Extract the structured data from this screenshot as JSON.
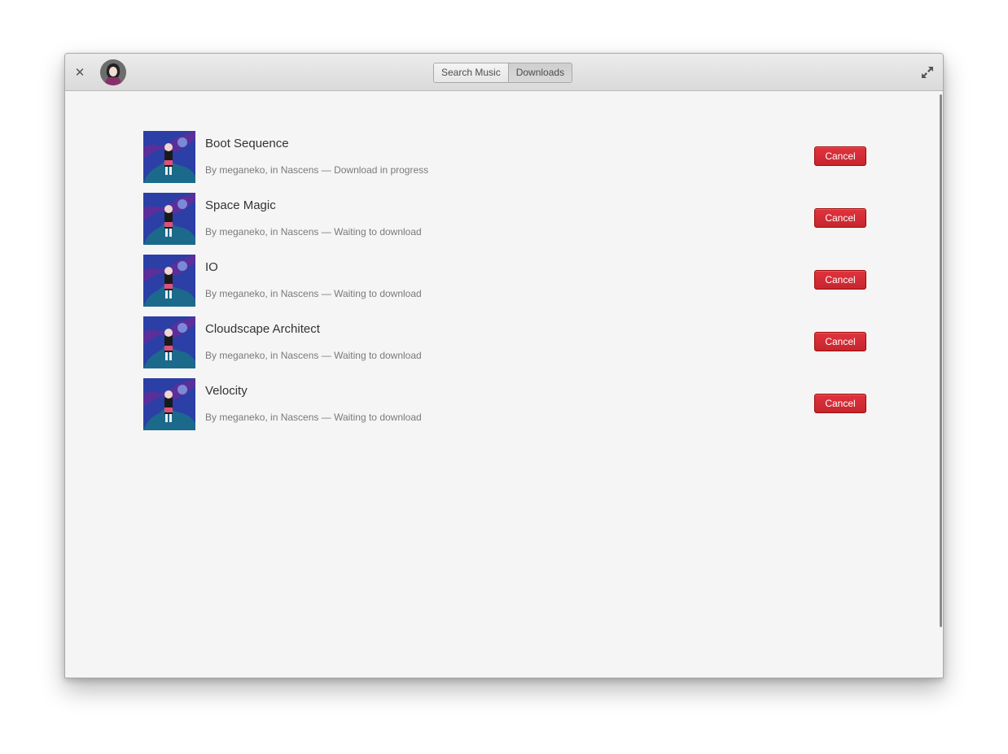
{
  "header": {
    "mode_tabs": [
      {
        "label": "Search Music",
        "active": false
      },
      {
        "label": "Downloads",
        "active": true
      }
    ]
  },
  "downloads": [
    {
      "title": "Boot Sequence",
      "subtitle": "By meganeko, in Nascens — Download in progress",
      "action": "Cancel"
    },
    {
      "title": "Space Magic",
      "subtitle": "By meganeko, in Nascens — Waiting to download",
      "action": "Cancel"
    },
    {
      "title": "IO",
      "subtitle": "By meganeko, in Nascens — Waiting to download",
      "action": "Cancel"
    },
    {
      "title": "Cloudscape Architect",
      "subtitle": "By meganeko, in Nascens — Waiting to download",
      "action": "Cancel"
    },
    {
      "title": "Velocity",
      "subtitle": "By meganeko, in Nascens — Waiting to download",
      "action": "Cancel"
    }
  ],
  "icons": {
    "close": "close-icon",
    "avatar": "avatar",
    "fullscreen": "fullscreen-icon",
    "album_art": "album-art"
  },
  "colors": {
    "cancel_button": "#c6262e",
    "window_bg": "#f5f5f5",
    "headerbar": "#dcdcdc"
  }
}
